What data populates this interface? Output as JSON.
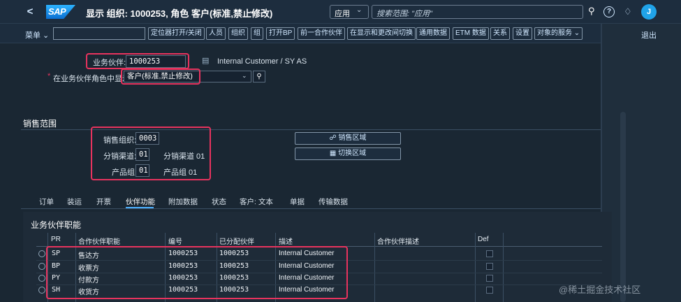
{
  "shell": {
    "title": "显示 组织: 1000253, 角色 客户(标准,禁止修改)",
    "logo": "SAP",
    "search_scope": "应用",
    "search_placeholder": "搜索范围: \"应用\"",
    "avatar_initial": "J"
  },
  "toolbar": {
    "menu": "菜单",
    "buttons": [
      "定位器打开/关闭",
      "人员",
      "组织",
      "组",
      "打开BP",
      "前一合作伙伴",
      "在显示和更改间切换",
      "通用数据",
      "ETM 数据",
      "关系",
      "设置",
      "对象的服务"
    ],
    "exit": "退出"
  },
  "header": {
    "bp_label": "业务伙伴:",
    "bp_value": "1000253",
    "bp_desc": "Internal Customer / SY AS",
    "role_label": "在业务伙伴角色中显示",
    "role_value": "客户(标准,禁止修改)",
    "required_mark": "*"
  },
  "sales_area": {
    "title": "销售范围",
    "org_label": "销售组织:",
    "org_value": "0003",
    "channel_label": "分销渠道:",
    "channel_value": "01",
    "channel_desc": "分销渠道 01",
    "division_label": "产品组:",
    "division_value": "01",
    "division_desc": "产品组 01",
    "btn_sales_area": "销售区域",
    "btn_switch_area": "切换区域"
  },
  "tabs": [
    "订单",
    "装运",
    "开票",
    "伙伴功能",
    "附加数据",
    "状态",
    "客户: 文本",
    "单据",
    "传输数据"
  ],
  "active_tab": "伙伴功能",
  "partner_table": {
    "title": "业务伙伴职能",
    "columns": [
      "PR",
      "合作伙伴职能",
      "编号",
      "已分配伙伴",
      "描述",
      "合作伙伴描述",
      "Def"
    ],
    "rows": [
      {
        "pr": "SP",
        "func": "售达方",
        "number": "1000253",
        "assigned": "1000253",
        "desc": "Internal Customer"
      },
      {
        "pr": "BP",
        "func": "收票方",
        "number": "1000253",
        "assigned": "1000253",
        "desc": "Internal Customer"
      },
      {
        "pr": "PY",
        "func": "付款方",
        "number": "1000253",
        "assigned": "1000253",
        "desc": "Internal Customer"
      },
      {
        "pr": "SH",
        "func": "收货方",
        "number": "1000253",
        "assigned": "1000253",
        "desc": "Internal Customer"
      }
    ]
  },
  "watermark": "@稀土掘金技术社区",
  "colors": {
    "highlight": "#e8335e",
    "accent": "#4db1ff",
    "background": "#1a2733"
  }
}
